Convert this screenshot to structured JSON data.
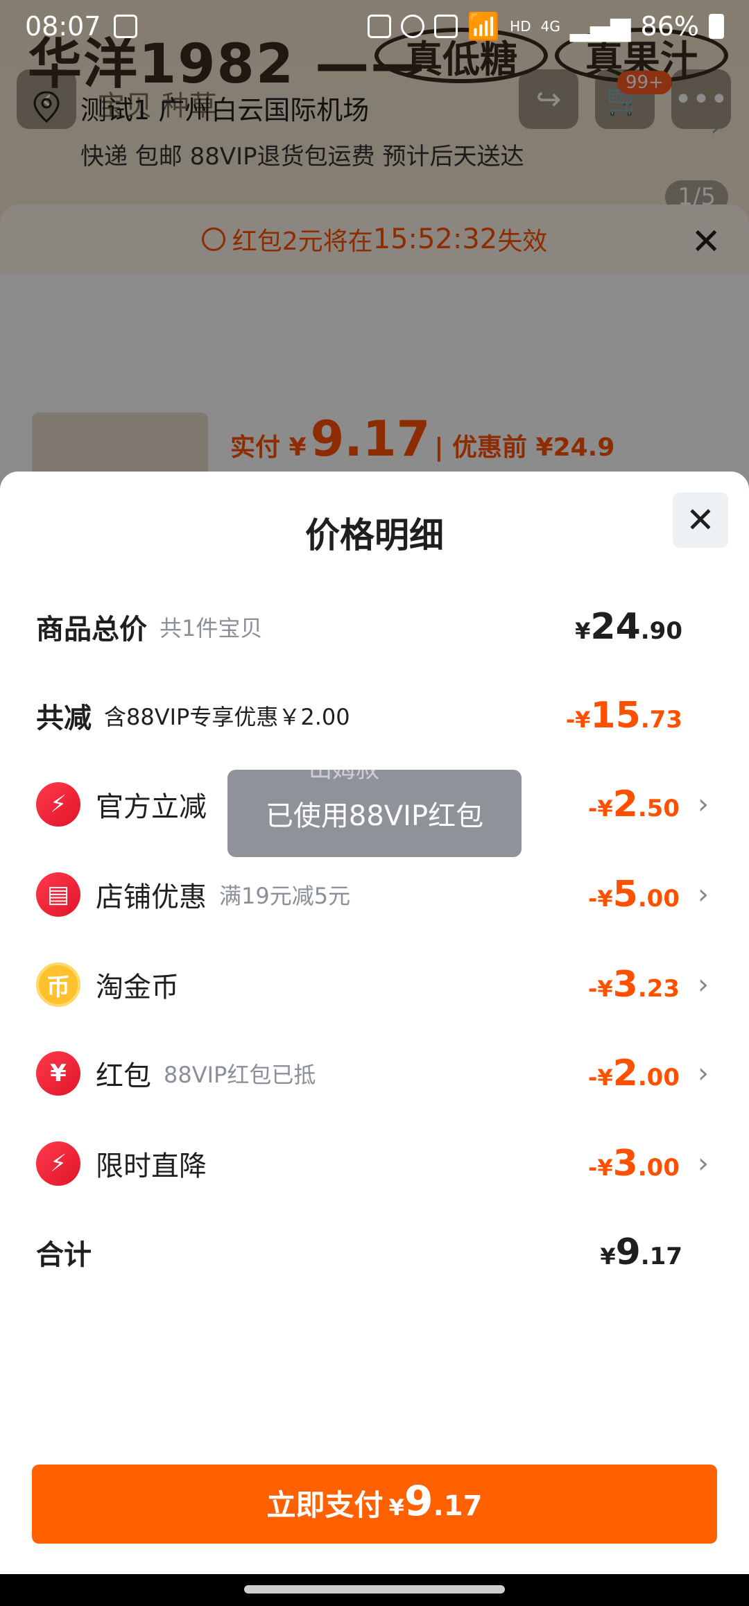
{
  "status_bar": {
    "time": "08:07",
    "hd": "HD",
    "net": "4G",
    "battery": "86%"
  },
  "background_page": {
    "brand": "华洋1982 ——",
    "oval1": "真低糖",
    "oval2": "真果汁",
    "tabs": "宝贝  种草",
    "cart_badge": "99+",
    "pager": "1/5"
  },
  "order_sheet": {
    "countdown_prefix": "红包2元将在",
    "countdown_time": "15:52:32",
    "countdown_suffix": "失效",
    "address_title": "测试1 广州白云国际机场",
    "address_sub": "快递 包邮 88VIP退货包运费 预计后天送达",
    "paid_label": "实付 ¥",
    "paid_value": "9.17",
    "before_label": "| 优惠前 ¥24.9"
  },
  "price_detail": {
    "title": "价格明细",
    "rows": [
      {
        "label": "商品总价",
        "note": "共1件宝贝",
        "sign": "",
        "cur": "¥",
        "int": "24",
        "dec": ".90"
      },
      {
        "label": "共减",
        "note": "含88VIP专享优惠￥2.00",
        "sign": "-",
        "cur": "¥",
        "int": "15",
        "dec": ".73"
      },
      {
        "label": "官方立减",
        "note": "",
        "sign": "-",
        "cur": "¥",
        "int": "2",
        "dec": ".50"
      },
      {
        "label": "店铺优惠",
        "note": "满19元减5元",
        "sign": "-",
        "cur": "¥",
        "int": "5",
        "dec": ".00"
      },
      {
        "label": "淘金币",
        "note": "",
        "sign": "-",
        "cur": "¥",
        "int": "3",
        "dec": ".23"
      },
      {
        "label": "红包",
        "note": "88VIP红包已抵",
        "sign": "-",
        "cur": "¥",
        "int": "2",
        "dec": ".00"
      },
      {
        "label": "限时直降",
        "note": "",
        "sign": "-",
        "cur": "¥",
        "int": "3",
        "dec": ".00"
      },
      {
        "label": "合计",
        "note": "",
        "sign": "",
        "cur": "¥",
        "int": "9",
        "dec": ".17"
      }
    ],
    "icons": {
      "coin_glyph": "币",
      "redpacket_glyph": "¥"
    }
  },
  "toast": {
    "text": "已使用88VIP红包",
    "ghost_text": "山姆叔"
  },
  "pay_button": {
    "label": "立即支付",
    "cur": "¥",
    "int": "9",
    "dec": ".17"
  }
}
